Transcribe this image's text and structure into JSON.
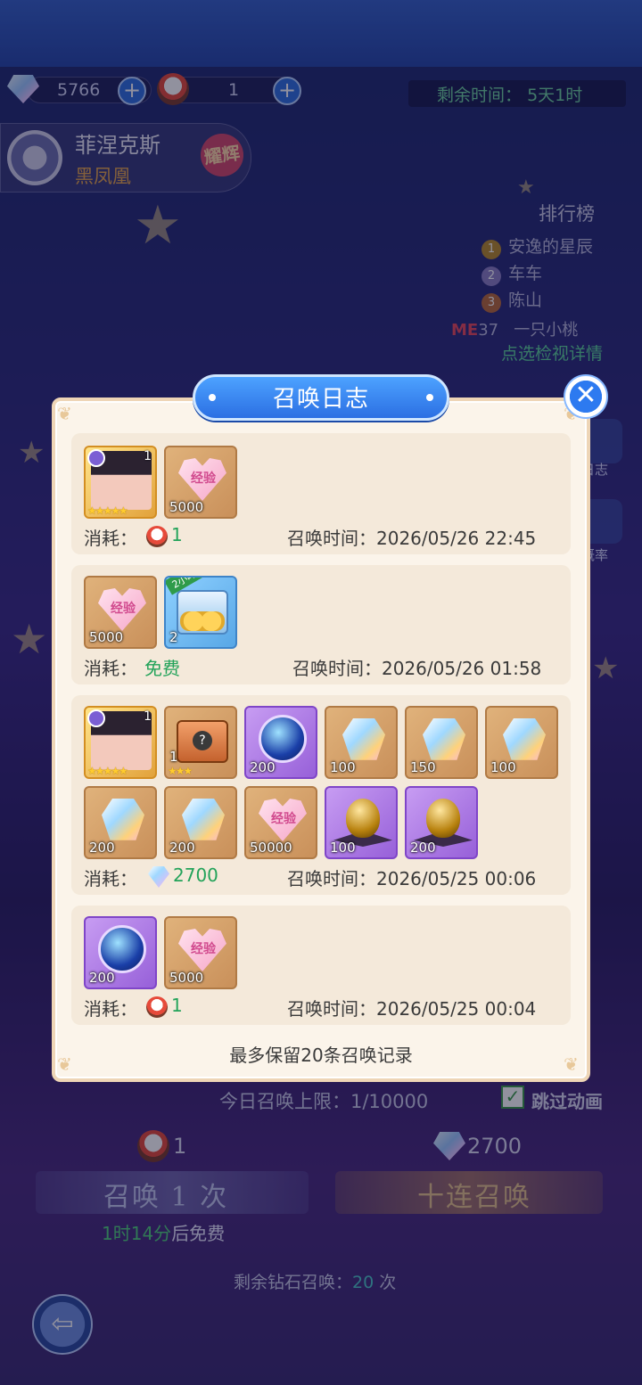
{
  "resources": {
    "diamonds": "5766",
    "summon_tickets": "1",
    "timer_label": "剩余时间：",
    "timer_value": "5天1时"
  },
  "character": {
    "name": "菲涅克斯",
    "subtitle": "黑凤凰",
    "badge": "耀辉"
  },
  "ranking": {
    "title": "排行榜",
    "entries": [
      {
        "rank": "1",
        "name": "安逸的星辰"
      },
      {
        "rank": "2",
        "name": "车车"
      },
      {
        "rank": "3",
        "name": "陈山"
      }
    ],
    "me_label": "ME",
    "me_rank": "37",
    "me_name": "一只小桃",
    "detail_link": "点选检视详情"
  },
  "side_buttons": [
    {
      "label": "日志",
      "icon": "log-icon"
    },
    {
      "label": "概率",
      "icon": "probability-icon"
    }
  ],
  "modal": {
    "title": "召唤日志",
    "close_icon": "close-icon",
    "cost_label": "消耗：",
    "time_label": "召唤时间：",
    "footer": "最多保留20条召唤记录",
    "entries": [
      {
        "items": [
          {
            "type": "hero",
            "count": "1",
            "stars": "★★★★★"
          },
          {
            "type": "exp",
            "label": "经验",
            "qty": "5000"
          }
        ],
        "cost": "1",
        "cost_icon": "ticket-bird-icon",
        "time": "2026/05/26 22:45"
      },
      {
        "items": [
          {
            "type": "exp",
            "label": "经验",
            "qty": "5000"
          },
          {
            "type": "chest",
            "ribbon": "2小时",
            "qty": "2"
          }
        ],
        "cost": "免费",
        "cost_icon": "",
        "time": "2026/05/26 01:58"
      },
      {
        "items": [
          {
            "type": "hero",
            "count": "1",
            "stars": "★★★★★"
          },
          {
            "type": "mystery",
            "qty": "1",
            "stars": "★★★"
          },
          {
            "type": "orb",
            "qty": "200"
          },
          {
            "type": "gem",
            "qty": "100"
          },
          {
            "type": "gem",
            "qty": "150"
          },
          {
            "type": "gem",
            "qty": "100"
          },
          {
            "type": "gem",
            "qty": "200"
          },
          {
            "type": "gem",
            "qty": "200"
          },
          {
            "type": "exp",
            "label": "经验",
            "qty": "50000"
          },
          {
            "type": "egg",
            "qty": "100"
          },
          {
            "type": "egg",
            "qty": "200"
          }
        ],
        "cost": "2700",
        "cost_icon": "diamond-icon",
        "time": "2026/05/25 00:06"
      },
      {
        "items": [
          {
            "type": "orb",
            "qty": "200"
          },
          {
            "type": "exp",
            "label": "经验",
            "qty": "5000"
          }
        ],
        "cost": "1",
        "cost_icon": "ticket-bird-icon",
        "time": "2026/05/25 00:04"
      }
    ]
  },
  "bottom": {
    "daily_limit_label": "今日召唤上限：",
    "daily_limit_value": "1/10000",
    "skip_animation": "跳过动画",
    "single_cost": "1",
    "ten_cost": "2700",
    "summon_once": "召唤 1 次",
    "summon_ten": "十连召唤",
    "free_time": "1时14分",
    "free_suffix": "后免费",
    "remaining_label": "剩余钻石召唤：",
    "remaining_value": "20",
    "remaining_unit": "次"
  },
  "colors": {
    "modal_bg": "#fbf4ea",
    "title_tab": "#2b6fe3",
    "cost_green": "#23a35a",
    "entry_bg": "#f4e9da"
  }
}
